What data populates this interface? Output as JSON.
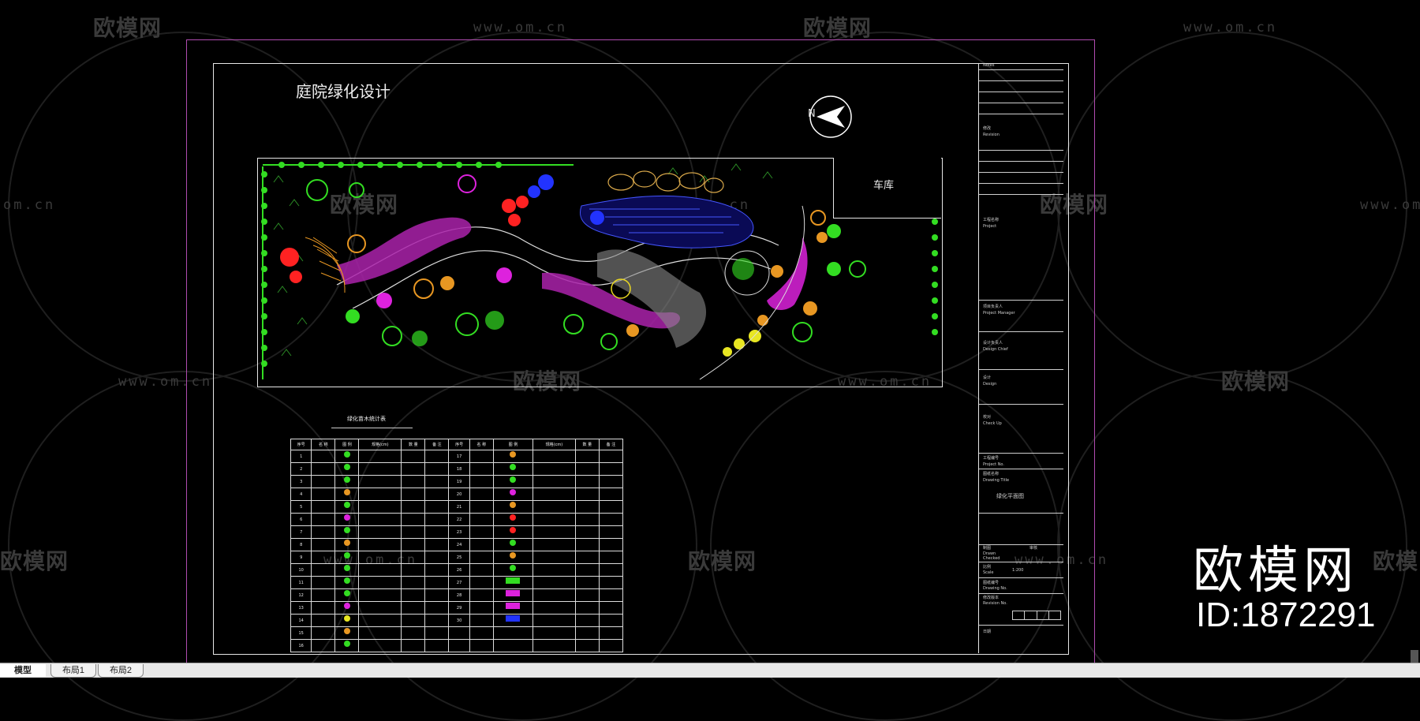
{
  "watermark": {
    "brand": "欧模网",
    "url": "www.om.cn",
    "url_fragment": "om.cn"
  },
  "brand_overlay": {
    "name": "欧模网",
    "id_text": "ID:1872291"
  },
  "drawing": {
    "title": "庭院绿化设计",
    "north_label": "N",
    "garage_label": "车库",
    "legend_title": "绿化苗木统计表"
  },
  "legend_table": {
    "headers": [
      "序号",
      "名 称",
      "图 例",
      "规格(cm)",
      "数 量",
      "备 注",
      "序号",
      "名 称",
      "图 例",
      "规格(cm)",
      "数 量",
      "备 注"
    ],
    "left_numbers": [
      "1",
      "2",
      "3",
      "4",
      "5",
      "6",
      "7",
      "8",
      "9",
      "10",
      "11",
      "12",
      "13",
      "14",
      "15",
      "16"
    ],
    "right_numbers": [
      "17",
      "18",
      "19",
      "20",
      "21",
      "22",
      "23",
      "24",
      "25",
      "26",
      "27",
      "28",
      "29",
      "30"
    ]
  },
  "title_block": {
    "labels": [
      "Notes",
      "修改",
      "Revision",
      "工程名称",
      "Project",
      "项目负责人",
      "Project Manager",
      "设计负责人",
      "Design Chief",
      "设计",
      "Design",
      "校对",
      "Check Up",
      "工程编号",
      "Project No.",
      "图纸名称",
      "Drawing Title",
      "绿化平面图",
      "制图",
      "Drawn",
      "审核",
      "Checked",
      "比例",
      "Scale",
      "1:200",
      "图纸编号",
      "Drawing No.",
      "修改版本",
      "Revision No.",
      "日期"
    ]
  },
  "tabs": [
    {
      "label": "模型",
      "active": true
    },
    {
      "label": "布局1",
      "active": false
    },
    {
      "label": "布局2",
      "active": false
    }
  ],
  "colors": {
    "sheet_border": "#b04cb0",
    "frame": "#e6e6e6",
    "plant_green": "#33dd22",
    "plant_magenta": "#dd22dd",
    "plant_red": "#ff2222",
    "water_blue": "#2233ff",
    "path_gray": "#aaaaaa"
  }
}
